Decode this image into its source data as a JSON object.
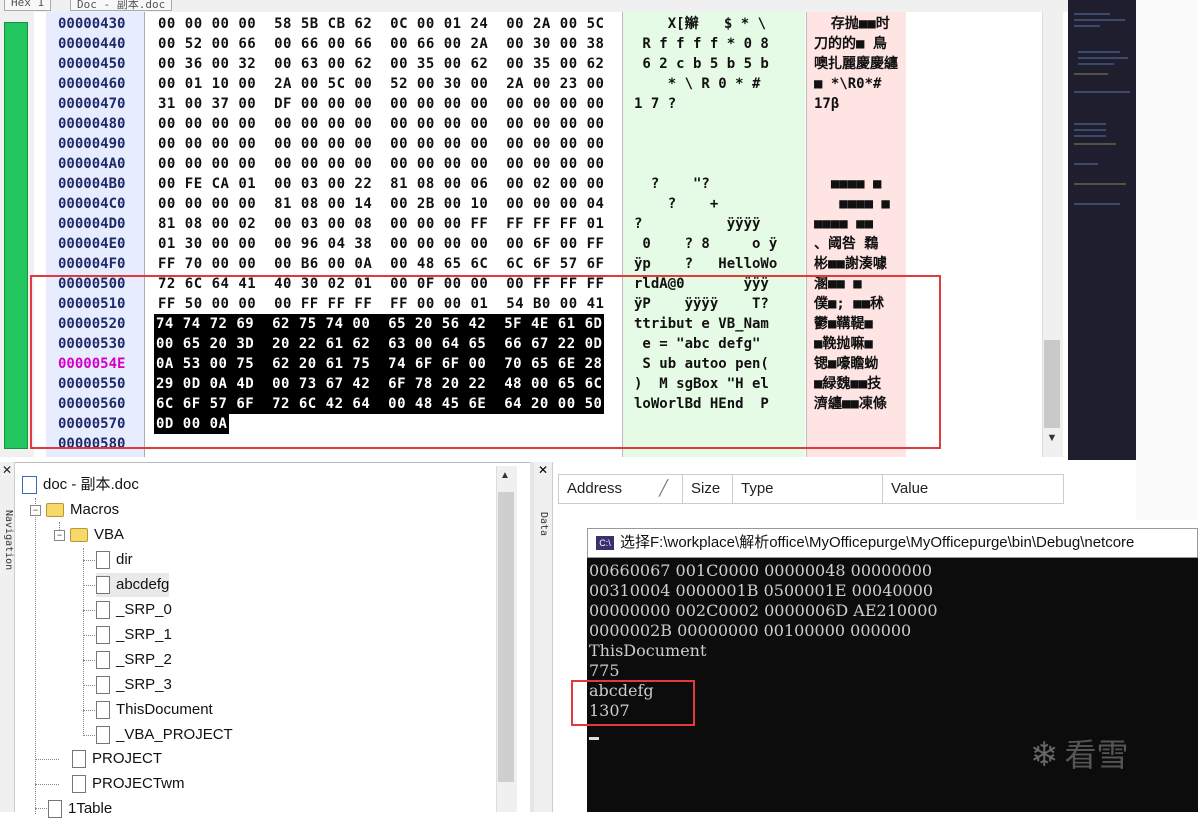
{
  "top_strip": {
    "tab1": "Hex 1",
    "tab2": "Doc - 副本.doc"
  },
  "hex_rows": [
    {
      "addr": "00000430",
      "hex": "00 00 00 00  58 5B CB 62  0C 00 01 24  00 2A 00 5C",
      "ascii": "    X[辮   $ * \\",
      "chn": "  存抛■■时"
    },
    {
      "addr": "00000440",
      "hex": "00 52 00 66  00 66 00 66  00 66 00 2A  00 30 00 38",
      "ascii": " R f f f f * 0 8",
      "chn": "刀的的■ 鳥"
    },
    {
      "addr": "00000450",
      "hex": "00 36 00 32  00 63 00 62  00 35 00 62  00 35 00 62",
      "ascii": " 6 2 c b 5 b 5 b",
      "chn": "噢扎麗慶慶纏"
    },
    {
      "addr": "00000460",
      "hex": "00 01 10 00  2A 00 5C 00  52 00 30 00  2A 00 23 00",
      "ascii": "    * \\ R 0 * #",
      "chn": "■ *\\R0*#"
    },
    {
      "addr": "00000470",
      "hex": "31 00 37 00  DF 00 00 00  00 00 00 00  00 00 00 00",
      "ascii": "1 7 ?",
      "chn": "17β"
    },
    {
      "addr": "00000480",
      "hex": "00 00 00 00  00 00 00 00  00 00 00 00  00 00 00 00",
      "ascii": "",
      "chn": ""
    },
    {
      "addr": "00000490",
      "hex": "00 00 00 00  00 00 00 00  00 00 00 00  00 00 00 00",
      "ascii": "",
      "chn": ""
    },
    {
      "addr": "000004A0",
      "hex": "00 00 00 00  00 00 00 00  00 00 00 00  00 00 00 00",
      "ascii": "",
      "chn": ""
    },
    {
      "addr": "000004B0",
      "hex": "00 FE CA 01  00 03 00 22  81 08 00 06  00 02 00 00",
      "ascii": "  ?    \"?",
      "chn": "  ■■■■ ■"
    },
    {
      "addr": "000004C0",
      "hex": "00 00 00 00  81 08 00 14  00 2B 00 10  00 00 00 04",
      "ascii": "    ?    +",
      "chn": "   ■■■■ ■"
    },
    {
      "addr": "000004D0",
      "hex": "81 08 00 02  00 03 00 08  00 00 00 FF  FF FF FF 01",
      "ascii": "?          ÿÿÿÿ",
      "chn": "■■■■ ■■"
    },
    {
      "addr": "000004E0",
      "hex": "01 30 00 00  00 96 04 38  00 00 00 00  00 6F 00 FF",
      "ascii": " 0    ? 8     o ÿ",
      "chn": "、阈咎 鶔"
    },
    {
      "addr": "000004F0",
      "hex": "FF 70 00 00  00 B6 00 0A  00 48 65 6C  6C 6F 57 6F",
      "ascii": "ÿp    ?   HelloWo",
      "chn": "彬■■謝湊噱"
    },
    {
      "addr": "00000500",
      "hex": "72 6C 64 41  40 30 02 01  00 0F 00 00  00 FF FF FF",
      "ascii": "rldA@0       ÿÿÿ",
      "chn": "溷■■ ■"
    },
    {
      "addr": "00000510",
      "hex": "FF 50 00 00  00 FF FF FF  FF 00 00 01  54 B0 00 41",
      "ascii": "ÿP    ÿÿÿÿ    T?",
      "chn": "僕■; ■■秫"
    },
    {
      "addr": "00000520",
      "hex": "74 74 72 69  62 75 74 00  65 20 56 42  5F 4E 61 6D",
      "ascii": "ttribut e VB_Nam",
      "chn": "鬱■鞲鞮■"
    },
    {
      "addr": "00000530",
      "hex": "00 65 20 3D  20 22 61 62  63 00 64 65  66 67 22 0D",
      "ascii": " e = \"abc defg\"",
      "chn": "■鞔抛嘛■"
    },
    {
      "addr": "0000054E",
      "hex": "0A 53 00 75  62 20 61 75  74 6F 6F 00  70 65 6E 28",
      "ascii": " S ub autoo pen(",
      "chn": "锶■嚎瞻蚴"
    },
    {
      "addr": "00000550",
      "hex": "29 0D 0A 4D  00 73 67 42  6F 78 20 22  48 00 65 6C",
      "ascii": ")  M sgBox \"H el",
      "chn": "■緑魏■■技"
    },
    {
      "addr": "00000560",
      "hex": "6C 6F 57 6F  72 6C 42 64  00 48 45 6E  64 20 00 50",
      "ascii": "loWorlBd HEnd  P",
      "chn": "濟纏■■凍條"
    },
    {
      "addr": "00000570",
      "hex": "0D 00 0A",
      "ascii": "",
      "chn": ""
    },
    {
      "addr": "00000580",
      "hex": "",
      "ascii": "",
      "chn": ""
    }
  ],
  "navigator": {
    "strip_label": "Navigation",
    "root": "doc - 副本.doc",
    "items": [
      "Macros",
      "VBA",
      "dir",
      "abcdefg",
      "_SRP_0",
      "_SRP_1",
      "_SRP_2",
      "_SRP_3",
      "ThisDocument",
      "_VBA_PROJECT",
      "PROJECT",
      "PROJECTwm",
      "1Table"
    ]
  },
  "data_panel": {
    "strip_label": "Data",
    "columns": [
      "Address",
      "Size",
      "Type",
      "Value"
    ]
  },
  "console": {
    "title": "选择F:\\workplace\\解析office\\MyOfficepurge\\MyOfficepurge\\bin\\Debug\\netcore",
    "lines": [
      "00660067 001C0000 00000048 00000000",
      "00310004 0000001B 0500001E 00040000",
      "00000000 002C0002 0000006D AE210000",
      "0000002B 00000000 00100000 000000",
      "ThisDocument",
      "775",
      "abcdefg",
      "1307"
    ]
  },
  "watermark": "看雪",
  "colors": {
    "highlight_red": "#e03a3a",
    "green_bar": "#22c55e",
    "addr_bg": "#e8ecff",
    "ascii_bg": "#e6fbe6",
    "chn_bg": "#ffe4e4"
  }
}
